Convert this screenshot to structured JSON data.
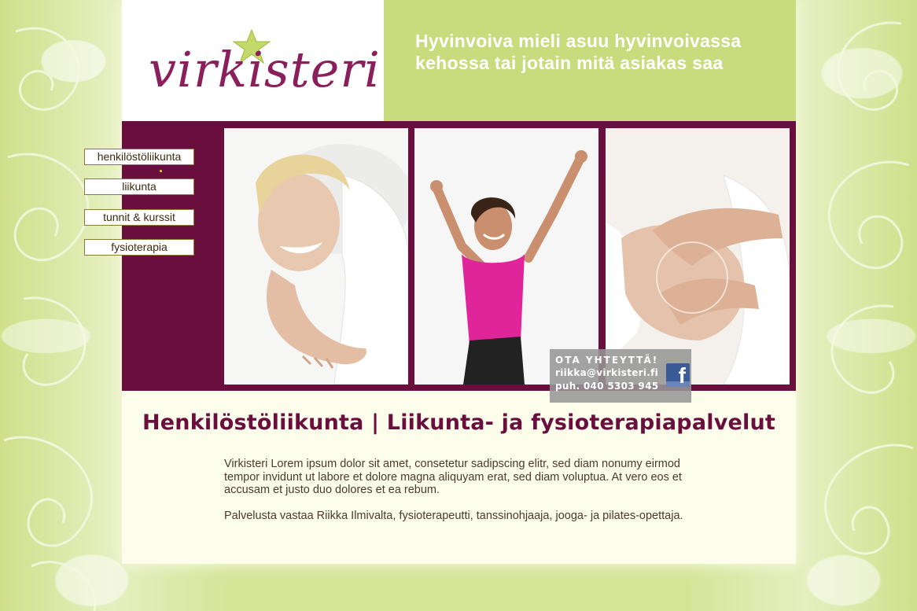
{
  "logo": {
    "text": "virkisteri"
  },
  "header": {
    "tagline": "Hyvinvoiva mieli asuu hyvinvoivassa kehossa tai jotain mitä asiakas saa"
  },
  "nav": {
    "items": [
      {
        "label": "henkilöstöliikunta"
      },
      {
        "label": "liikunta"
      },
      {
        "label": "tunnit & kurssit"
      },
      {
        "label": "fysioterapia"
      }
    ]
  },
  "contact": {
    "title": "OTA YHTEYTTÄ!",
    "email": "riikka@virkisteri.fi",
    "phone": "puh. 040 5303 945",
    "social_icon": "facebook-icon"
  },
  "main": {
    "title": "Henkilöstöliikunta | Liikunta- ja fysioterapiapalvelut",
    "paragraphs": [
      "Virkisteri Lorem ipsum dolor sit amet, consetetur sadipscing elitr, sed diam nonumy eirmod tempor invidunt ut labore et dolore magna aliquyam erat, sed diam voluptua. At vero eos et accusam et justo duo dolores et ea rebum.",
      "Palvelusta vastaa Riikka Ilmivalta, fysioterapeutti, tanssinohjaaja, jooga- ja pilates-opettaja."
    ]
  },
  "colors": {
    "brand": "#6a0f3d",
    "logo": "#8a1f5c",
    "accent_green": "#c8dc7d",
    "background": "#d9e6a6"
  }
}
